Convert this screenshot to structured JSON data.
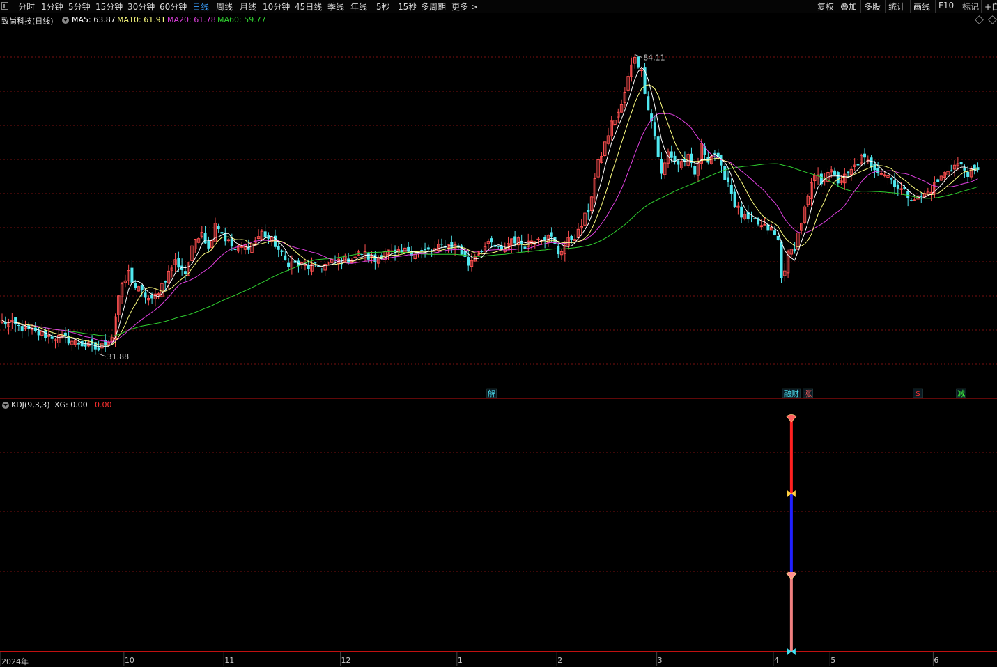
{
  "toolbar": {
    "periods": [
      {
        "label": "分时",
        "active": false
      },
      {
        "label": "1分钟",
        "active": false
      },
      {
        "label": "5分钟",
        "active": false
      },
      {
        "label": "15分钟",
        "active": false
      },
      {
        "label": "30分钟",
        "active": false
      },
      {
        "label": "60分钟",
        "active": false
      },
      {
        "label": "日线",
        "active": true
      },
      {
        "label": "周线",
        "active": false
      },
      {
        "label": "月线",
        "active": false
      },
      {
        "label": "10分钟",
        "active": false
      },
      {
        "label": "45日线",
        "active": false
      },
      {
        "label": "季线",
        "active": false
      },
      {
        "label": "年线",
        "active": false
      },
      {
        "label": "5秒",
        "active": false
      },
      {
        "label": "15秒",
        "active": false
      },
      {
        "label": "多周期",
        "active": false
      },
      {
        "label": "更多 >",
        "active": false
      }
    ],
    "right": [
      "复权",
      "叠加",
      "多股",
      "统计",
      "画线",
      "F10",
      "标记",
      "+自"
    ]
  },
  "main_info": {
    "title": "致尚科技(日线)",
    "ma5": "MA5: 63.87",
    "ma10": "MA10: 61.91",
    "ma20": "MA20: 61.78",
    "ma60": "MA60: 59.77"
  },
  "sub_info": {
    "title": "KDJ(9,3,3)",
    "xg": "XG: 0.00",
    "val": "0.00"
  },
  "markers": [
    {
      "label": "解",
      "date_index": 147,
      "color": "#4ad8e8"
    },
    {
      "label": "融财",
      "date_index": 237,
      "color": "#4ad8e8"
    },
    {
      "label": "涨",
      "date_index": 242,
      "color": "#ff6060"
    },
    {
      "label": "$",
      "date_index": 275,
      "color": "#ff3030"
    },
    {
      "label": "减",
      "date_index": 288,
      "color": "#40ff40"
    }
  ],
  "colors": {
    "up": "#ff5050",
    "down": "#50e8f0",
    "ma5": "#ffffff",
    "ma10": "#ffff80",
    "ma20": "#e040e0",
    "ma60": "#30d030",
    "grid": "#7a1010",
    "border": "#c01010",
    "bg": "#000000",
    "kdj_red": "#ff2020",
    "kdj_blue": "#2020ff",
    "kdj_pink": "#f08080"
  },
  "chart_data": [
    {
      "type": "candlestick",
      "title": "致尚科技(日线)",
      "ylim": [
        28,
        90
      ],
      "x_month_labels": [
        {
          "label": "2024年",
          "index": 0
        },
        {
          "label": "10",
          "index": 37
        },
        {
          "label": "11",
          "index": 67
        },
        {
          "label": "12",
          "index": 102
        },
        {
          "label": "1",
          "index": 137
        },
        {
          "label": "2",
          "index": 167
        },
        {
          "label": "3",
          "index": 197
        },
        {
          "label": "4",
          "index": 232
        },
        {
          "label": "5",
          "index": 249
        },
        {
          "label": "6",
          "index": 280
        }
      ],
      "max_label": {
        "text": "84.11",
        "index": 190,
        "value": 84.11
      },
      "min_label": {
        "text": "31.88",
        "index": 29,
        "value": 31.88
      },
      "anchors": [
        [
          0,
          37.5
        ],
        [
          10,
          35.5
        ],
        [
          20,
          34.3
        ],
        [
          29,
          32.6
        ],
        [
          33,
          35
        ],
        [
          35,
          42
        ],
        [
          38,
          46
        ],
        [
          40,
          43.5
        ],
        [
          45,
          41
        ],
        [
          48,
          44
        ],
        [
          52,
          48
        ],
        [
          55,
          46
        ],
        [
          58,
          52
        ],
        [
          60,
          53.5
        ],
        [
          62,
          50
        ],
        [
          64,
          55
        ],
        [
          67,
          52
        ],
        [
          70,
          50
        ],
        [
          75,
          51
        ],
        [
          78,
          53
        ],
        [
          80,
          52
        ],
        [
          82,
          51
        ],
        [
          85,
          48
        ],
        [
          88,
          47.5
        ],
        [
          92,
          47
        ],
        [
          95,
          47
        ],
        [
          100,
          48
        ],
        [
          105,
          48.5
        ],
        [
          108,
          49.5
        ],
        [
          112,
          48
        ],
        [
          115,
          50
        ],
        [
          118,
          49
        ],
        [
          122,
          50
        ],
        [
          125,
          49.5
        ],
        [
          130,
          50
        ],
        [
          133,
          51
        ],
        [
          137,
          50.5
        ],
        [
          140,
          47.5
        ],
        [
          143,
          50
        ],
        [
          147,
          51
        ],
        [
          150,
          49.5
        ],
        [
          153,
          52
        ],
        [
          157,
          51
        ],
        [
          161,
          52.5
        ],
        [
          165,
          52
        ],
        [
          167,
          49.5
        ],
        [
          170,
          51.5
        ],
        [
          173,
          53
        ],
        [
          176,
          57
        ],
        [
          179,
          65
        ],
        [
          183,
          72
        ],
        [
          186,
          75
        ],
        [
          188,
          80
        ],
        [
          190,
          84
        ],
        [
          192,
          81
        ],
        [
          194,
          75
        ],
        [
          196,
          70
        ],
        [
          198,
          63
        ],
        [
          200,
          67
        ],
        [
          203,
          65
        ],
        [
          206,
          66
        ],
        [
          208,
          63
        ],
        [
          210,
          68
        ],
        [
          212,
          66
        ],
        [
          214,
          67
        ],
        [
          216,
          64
        ],
        [
          218,
          62
        ],
        [
          220,
          58
        ],
        [
          222,
          56
        ],
        [
          224,
          55
        ],
        [
          226,
          55
        ],
        [
          228,
          54
        ],
        [
          231,
          53.5
        ],
        [
          233,
          51.5
        ],
        [
          234,
          45
        ],
        [
          236,
          49
        ],
        [
          238,
          50.5
        ],
        [
          240,
          55
        ],
        [
          242,
          59
        ],
        [
          244,
          63
        ],
        [
          246,
          62
        ],
        [
          248,
          64
        ],
        [
          251,
          62
        ],
        [
          254,
          63
        ],
        [
          258,
          66
        ],
        [
          262,
          64.5
        ],
        [
          266,
          63
        ],
        [
          269,
          61
        ],
        [
          272,
          59.5
        ],
        [
          275,
          59
        ],
        [
          278,
          60
        ],
        [
          281,
          62
        ],
        [
          284,
          64
        ],
        [
          287,
          65
        ],
        [
          290,
          63.5
        ],
        [
          293,
          63.5
        ]
      ],
      "ma_latest": {
        "MA5": 63.87,
        "MA10": 61.91,
        "MA20": 61.78,
        "MA60": 59.77
      }
    },
    {
      "type": "line",
      "title": "KDJ(9,3,3)",
      "series": [
        {
          "name": "XG",
          "values": [
            0.0
          ]
        }
      ],
      "signal_index": 237
    }
  ]
}
